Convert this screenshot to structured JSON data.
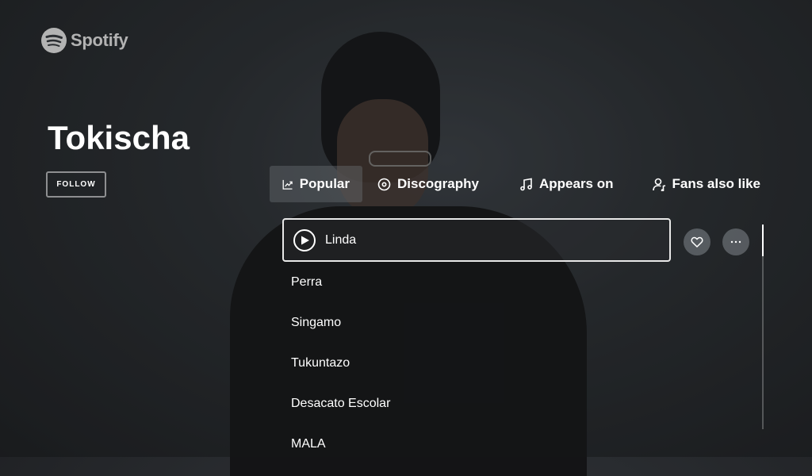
{
  "app": {
    "logo_text": "Spotify"
  },
  "artist": {
    "name": "Tokischa",
    "follow_label": "FOLLOW"
  },
  "tabs": [
    {
      "label": "Popular",
      "icon": "trending-icon",
      "active": true
    },
    {
      "label": "Discography",
      "icon": "disc-icon",
      "active": false
    },
    {
      "label": "Appears on",
      "icon": "music-note-icon",
      "active": false
    },
    {
      "label": "Fans also like",
      "icon": "user-music-icon",
      "active": false
    }
  ],
  "tracks": [
    {
      "title": "Linda",
      "selected": true
    },
    {
      "title": "Perra"
    },
    {
      "title": "Singamo"
    },
    {
      "title": "Tukuntazo"
    },
    {
      "title": "Desacato Escolar"
    },
    {
      "title": "MALA"
    }
  ],
  "actions": {
    "like_icon": "heart-icon",
    "more_icon": "more-horizontal-icon"
  },
  "colors": {
    "text": "#ffffff",
    "muted": "#b3b3b3",
    "background": "#2a2d31"
  }
}
